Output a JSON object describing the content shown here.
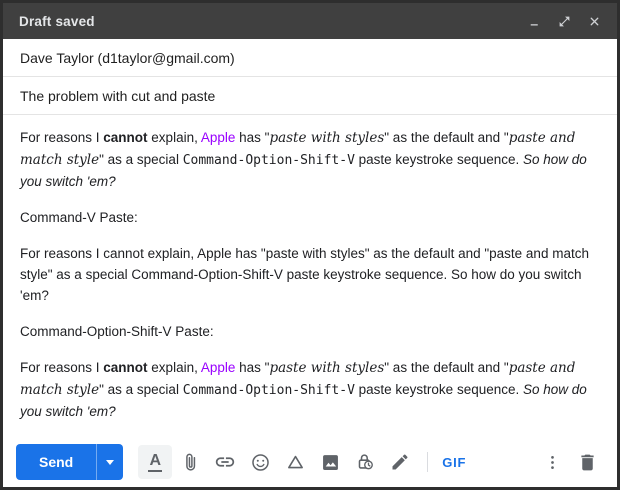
{
  "window": {
    "title": "Draft saved"
  },
  "recipient": {
    "value": "Dave Taylor (d1taylor@gmail.com)"
  },
  "subject": {
    "value": "The problem with cut and paste"
  },
  "body": {
    "styled_segments": [
      {
        "style": "plain",
        "text": "For reasons I "
      },
      {
        "style": "bold",
        "text": "cannot"
      },
      {
        "style": "plain",
        "text": " explain, "
      },
      {
        "style": "purple",
        "text": "Apple"
      },
      {
        "style": "plain",
        "text": " has \""
      },
      {
        "style": "fancy",
        "text": "paste with styles"
      },
      {
        "style": "plain",
        "text": "\" as the default and \""
      },
      {
        "style": "fancy",
        "text": "paste and match style"
      },
      {
        "style": "plain",
        "text": "\" as a special "
      },
      {
        "style": "mono",
        "text": "Command-Option-Shift-V"
      },
      {
        "style": "plain",
        "text": " paste keystroke sequence. "
      },
      {
        "style": "italic",
        "text": "So how do you switch 'em?"
      }
    ],
    "heading_command_v": "Command-V Paste:",
    "plain_paragraph": "For reasons I cannot explain, Apple has \"paste with styles\" as the default and \"paste and match style\" as a special Command-Option-Shift-V paste keystroke sequence. So how do you switch 'em?",
    "heading_command_option_shift_v": "Command-Option-Shift-V Paste:"
  },
  "toolbar": {
    "send_label": "Send",
    "formatting_label": "A",
    "gif_label": "GIF",
    "icons": [
      "formatting-options",
      "attach-files",
      "insert-link",
      "insert-emoji",
      "insert-from-drive",
      "insert-photo",
      "confidential-mode",
      "insert-signature-pen",
      "more-options",
      "discard-draft"
    ]
  },
  "colors": {
    "titlebar_bg": "#404040",
    "send_button_blue": "#1a73e8",
    "gif_blue": "#1a73e8",
    "link_purple": "#9900ff",
    "icon_gray": "#5f6368",
    "active_button_bg": "#f1f3f4"
  }
}
